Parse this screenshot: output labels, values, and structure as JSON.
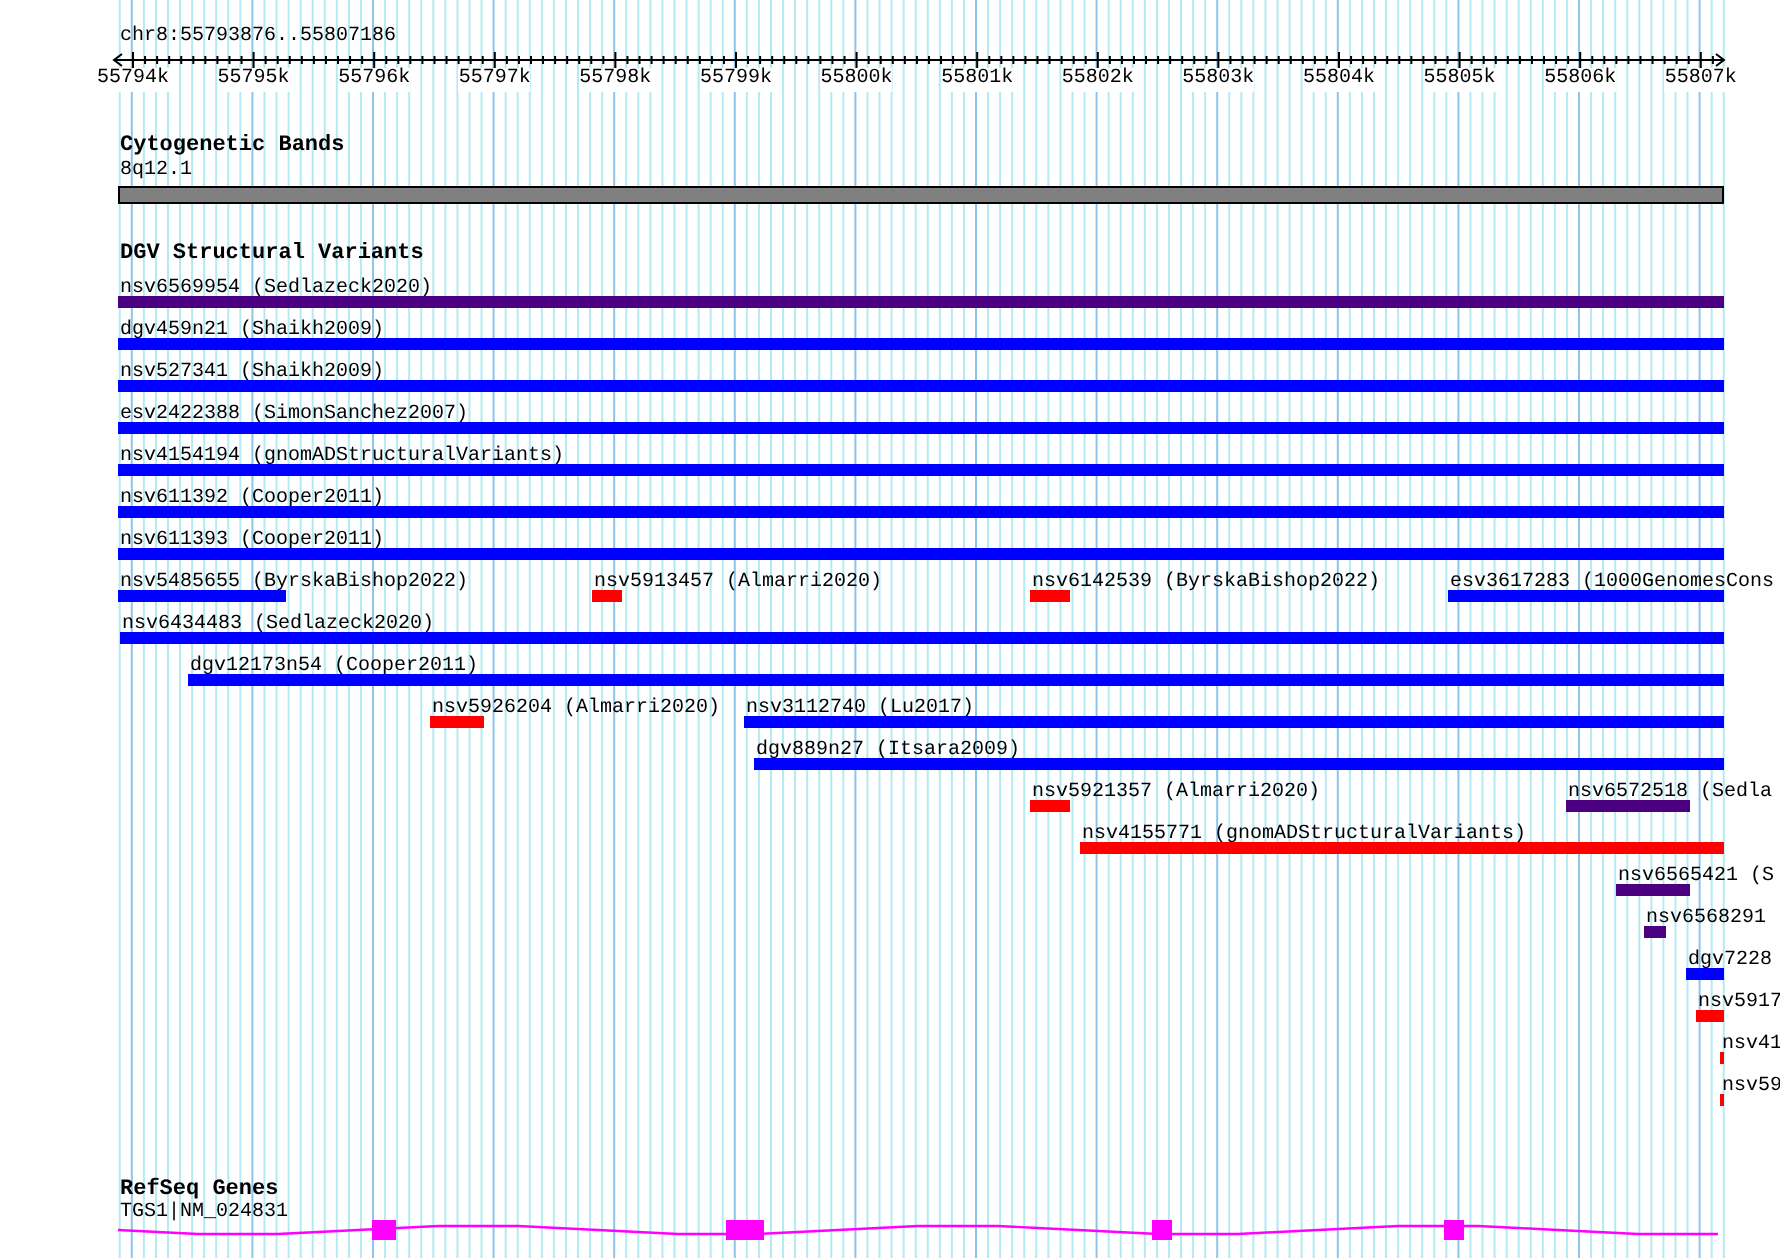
{
  "ruler": {
    "location": "chr8:55793876..55807186",
    "ticks": [
      "55794k",
      "55795k",
      "55796k",
      "55797k",
      "55798k",
      "55799k",
      "55800k",
      "55801k",
      "55802k",
      "55803k",
      "55804k",
      "55805k",
      "55806k",
      "55807k"
    ]
  },
  "tracks": [
    {
      "kind": "bands",
      "title": "Cytogenetic Bands",
      "features": [
        {
          "label": "8q12.1",
          "color": "#808080"
        }
      ]
    },
    {
      "kind": "variants",
      "title": "DGV Structural Variants",
      "features": [
        {
          "label": "nsv6569954 (Sedlazeck2020)",
          "color": "#4b0082"
        },
        {
          "label": "dgv459n21 (Shaikh2009)",
          "color": "#0000ff"
        },
        {
          "label": "nsv527341 (Shaikh2009)",
          "color": "#0000ff"
        },
        {
          "label": "esv2422388 (SimonSanchez2007)",
          "color": "#0000ff"
        },
        {
          "label": "nsv4154194 (gnomADStructuralVariants)",
          "color": "#0000ff"
        },
        {
          "label": "nsv611392 (Cooper2011)",
          "color": "#0000ff"
        },
        {
          "label": "nsv611393 (Cooper2011)",
          "color": "#0000ff"
        },
        {
          "label": "nsv5485655 (ByrskaBishop2022)",
          "color": "#0000ff"
        },
        {
          "label": "nsv5913457 (Almarri2020)",
          "color": "#ff0000"
        },
        {
          "label": "nsv6142539 (ByrskaBishop2022)",
          "color": "#ff0000"
        },
        {
          "label": "esv3617283 (1000GenomesCons",
          "color": "#0000ff"
        },
        {
          "label": "nsv6434483 (Sedlazeck2020)",
          "color": "#0000ff"
        },
        {
          "label": "dgv12173n54 (Cooper2011)",
          "color": "#0000ff"
        },
        {
          "label": "nsv5926204 (Almarri2020)",
          "color": "#ff0000"
        },
        {
          "label": "nsv3112740 (Lu2017)",
          "color": "#0000ff"
        },
        {
          "label": "dgv889n27 (Itsara2009)",
          "color": "#0000ff"
        },
        {
          "label": "nsv5921357 (Almarri2020)",
          "color": "#ff0000"
        },
        {
          "label": "nsv6572518 (Sedla",
          "color": "#4b0082"
        },
        {
          "label": "nsv4155771 (gnomADStructuralVariants)",
          "color": "#ff0000"
        },
        {
          "label": "nsv6565421 (S",
          "color": "#4b0082"
        },
        {
          "label": "nsv6568291",
          "color": "#4b0082"
        },
        {
          "label": "dgv7228",
          "color": "#0000ff"
        },
        {
          "label": "nsv5917",
          "color": "#ff0000"
        },
        {
          "label": "nsv41",
          "color": "#ff0000"
        },
        {
          "label": "nsv59",
          "color": "#ff0000"
        }
      ]
    },
    {
      "kind": "genes",
      "title": "RefSeq Genes",
      "features": [
        {
          "label": "TGS1|NM_024831",
          "color": "#ff00ff"
        }
      ]
    }
  ]
}
